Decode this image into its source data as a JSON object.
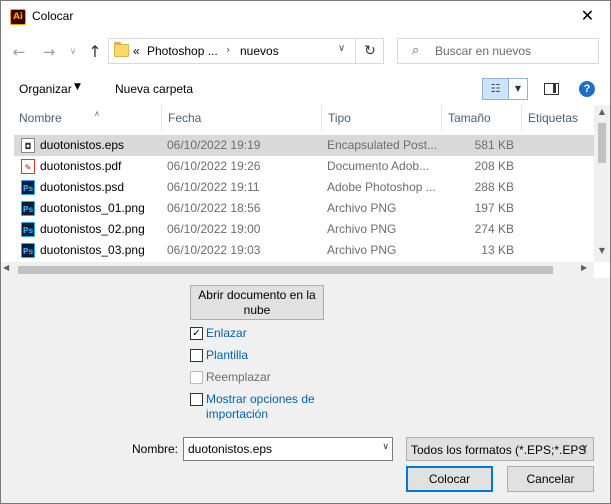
{
  "window": {
    "app_icon_text": "Ai",
    "title": "Colocar",
    "close_glyph": "✕"
  },
  "nav": {
    "back_glyph": "←",
    "forward_glyph": "→",
    "recent_glyph": "∨",
    "up_glyph": "↑",
    "breadcrumb_prefix": "«",
    "breadcrumb": [
      "Photoshop ...",
      "nuevos"
    ],
    "chevron": "›",
    "refresh_glyph": "↻",
    "search_placeholder": "Buscar en nuevos"
  },
  "toolbar": {
    "organize_label": "Organizar",
    "new_folder_label": "Nueva carpeta",
    "help_glyph": "?"
  },
  "columns": {
    "name": "Nombre",
    "date": "Fecha",
    "type": "Tipo",
    "size": "Tamaño",
    "tags": "Etiquetas"
  },
  "files": [
    {
      "icon": "eps",
      "icon_text": "◘",
      "name": "duotonistos.eps",
      "date": "06/10/2022 19:19",
      "type": "Encapsulated Post...",
      "size": "581 KB",
      "selected": true
    },
    {
      "icon": "pdf",
      "icon_text": "✎",
      "name": "duotonistos.pdf",
      "date": "06/10/2022 19:26",
      "type": "Documento Adob...",
      "size": "208 KB",
      "selected": false
    },
    {
      "icon": "ps",
      "icon_text": "Ps",
      "name": "duotonistos.psd",
      "date": "06/10/2022 19:11",
      "type": "Adobe Photoshop ...",
      "size": "288 KB",
      "selected": false
    },
    {
      "icon": "ps",
      "icon_text": "Ps",
      "name": "duotonistos_01.png",
      "date": "06/10/2022 18:56",
      "type": "Archivo PNG",
      "size": "197 KB",
      "selected": false
    },
    {
      "icon": "ps",
      "icon_text": "Ps",
      "name": "duotonistos_02.png",
      "date": "06/10/2022 19:00",
      "type": "Archivo PNG",
      "size": "274 KB",
      "selected": false
    },
    {
      "icon": "ps",
      "icon_text": "Ps",
      "name": "duotonistos_03.png",
      "date": "06/10/2022 19:03",
      "type": "Archivo PNG",
      "size": "13 KB",
      "selected": false
    }
  ],
  "options": {
    "cloud_button": "Abrir documento en la nube",
    "link": {
      "label": "Enlazar",
      "checked": true,
      "mark": "✓"
    },
    "template": {
      "label": "Plantilla",
      "checked": false
    },
    "replace": {
      "label": "Reemplazar",
      "checked": false,
      "disabled": true
    },
    "import_options": {
      "label": "Mostrar opciones de importación",
      "checked": false
    }
  },
  "bottom": {
    "name_label": "Nombre:",
    "filename": "duotonistos.eps",
    "filter": "Todos los formatos (*.EPS;*.EPS",
    "place_button": "Colocar",
    "cancel_button": "Cancelar"
  },
  "colors": {
    "accent": "#0078d7",
    "link": "#0063b1",
    "selection": "#d9d9d9",
    "header_text": "#4c607a"
  }
}
